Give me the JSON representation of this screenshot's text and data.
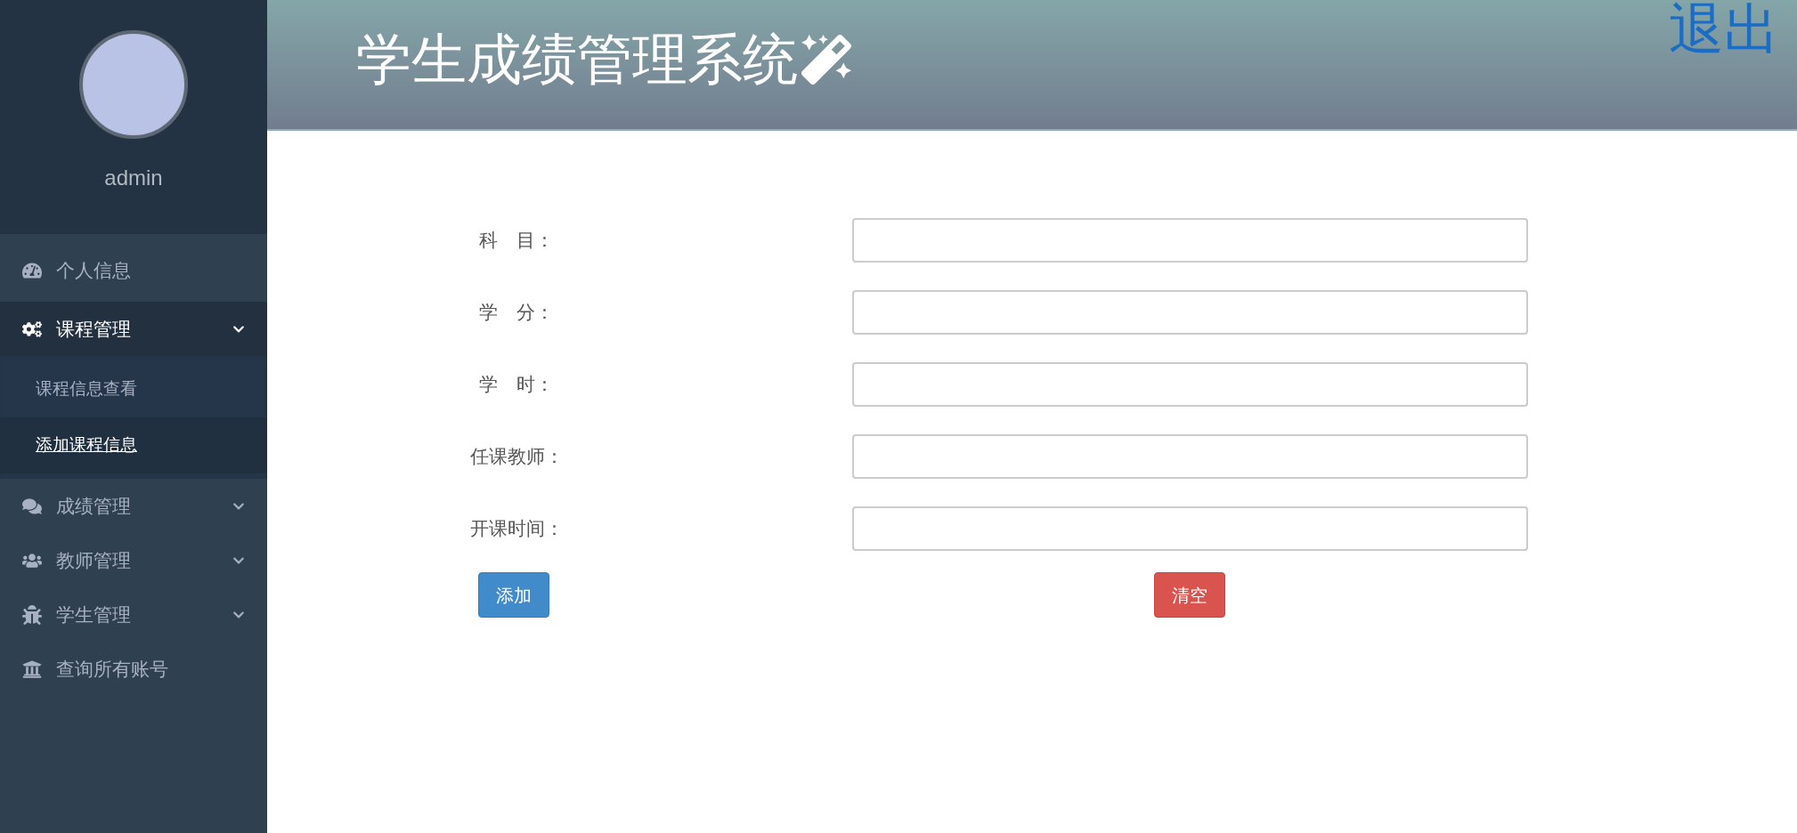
{
  "header": {
    "title": "学生成绩管理系统",
    "logout": "退出"
  },
  "sidebar": {
    "username": "admin",
    "items": [
      {
        "label": "个人信息",
        "expanded": false
      },
      {
        "label": "课程管理",
        "expanded": true,
        "has_caret": true,
        "children": [
          {
            "label": "课程信息查看",
            "selected": false
          },
          {
            "label": "添加课程信息",
            "selected": true
          }
        ]
      },
      {
        "label": "成绩管理",
        "expanded": false,
        "has_caret": true
      },
      {
        "label": "教师管理",
        "expanded": false,
        "has_caret": true
      },
      {
        "label": "学生管理",
        "expanded": false,
        "has_caret": true
      },
      {
        "label": "查询所有账号",
        "expanded": false
      }
    ]
  },
  "form": {
    "fields": [
      {
        "label": "科　目："
      },
      {
        "label": "学　分："
      },
      {
        "label": "学　时："
      },
      {
        "label": "任课教师："
      },
      {
        "label": "开课时间："
      }
    ],
    "buttons": [
      {
        "label": "添加",
        "kind": "primary"
      },
      {
        "label": "清空",
        "kind": "danger"
      }
    ]
  }
}
